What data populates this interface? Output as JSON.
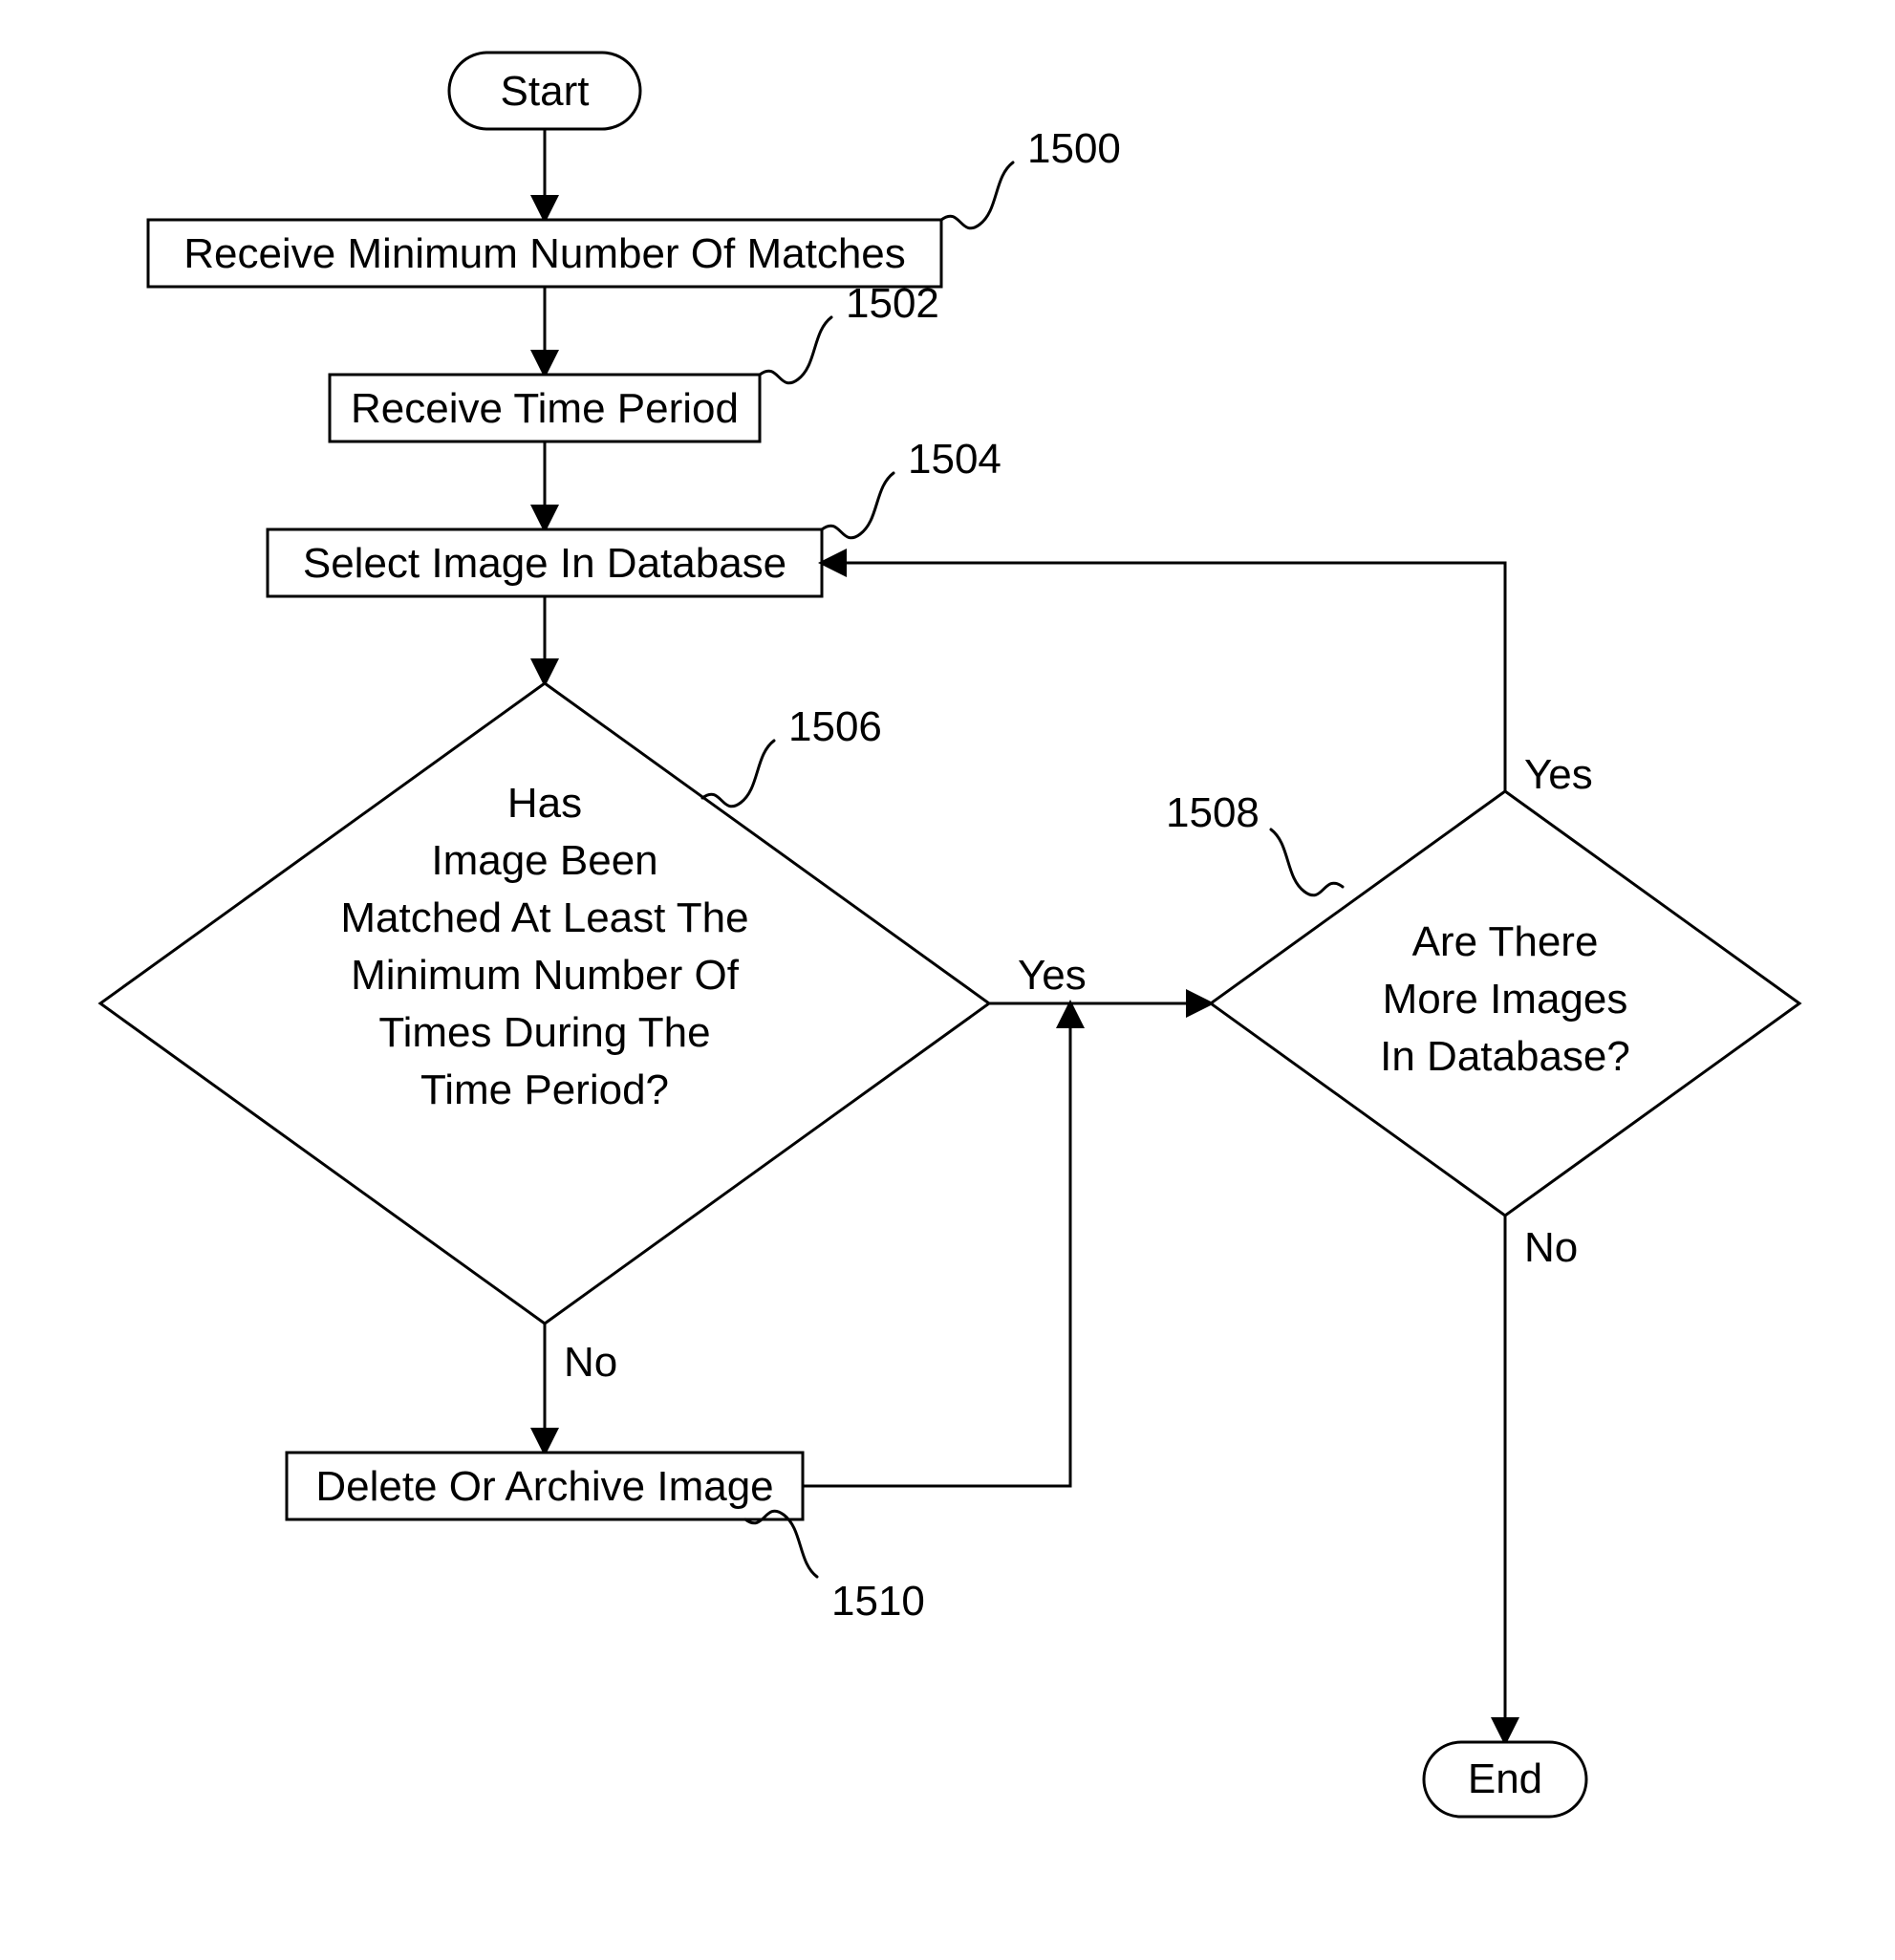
{
  "flowchart": {
    "start_label": "Start",
    "end_label": "End",
    "nodes": {
      "receive_min": {
        "text": "Receive Minimum Number Of Matches",
        "ref": "1500"
      },
      "receive_time": {
        "text": "Receive Time Period",
        "ref": "1502"
      },
      "select_image": {
        "text": "Select Image In Database",
        "ref": "1504"
      },
      "matched_decision": {
        "line1": "Has",
        "line2": "Image Been",
        "line3": "Matched At Least The",
        "line4": "Minimum Number Of",
        "line5": "Times During The",
        "line6": "Time Period?",
        "ref": "1506"
      },
      "more_images_decision": {
        "line1": "Are There",
        "line2": "More Images",
        "line3": "In Database?",
        "ref": "1508"
      },
      "delete_archive": {
        "text": "Delete Or Archive Image",
        "ref": "1510"
      }
    },
    "edge_labels": {
      "yes": "Yes",
      "no": "No"
    }
  }
}
